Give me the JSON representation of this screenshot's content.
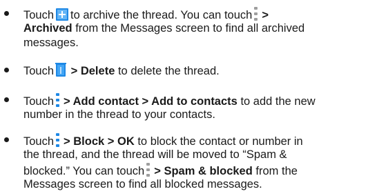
{
  "items": [
    {
      "l1a": "Touch",
      "l1b": "to archive the thread. You can touch",
      "l1c": ">",
      "l2a": "Archived",
      "l2b": "from the Messages screen to find all archived",
      "l3": "messages.",
      "icon1": "archive-icon",
      "icon2": "overflow-menu-icon"
    },
    {
      "a": "Touch",
      "b": "> Delete",
      "c": "to delete the thread.",
      "icon": "trash-icon"
    },
    {
      "a": "Touch",
      "b": "> Add contact > Add to contacts",
      "c": "to add the new",
      "l2": "number in the thread to your contacts.",
      "icon": "overflow-menu-icon"
    },
    {
      "a": "Touch",
      "b": "> Block > OK",
      "c": "to block the contact or number in",
      "l2": "the thread, and the thread will be moved to “Spam &",
      "l3a": "blocked.” You can touch",
      "l3b": "> Spam & blocked",
      "l3c": "from the",
      "l4": "Messages screen to find all blocked messages.",
      "icon": "overflow-menu-icon"
    }
  ],
  "colors": {
    "text": "#1a1a1a",
    "icon_blue": "#1e88e5",
    "icon_grey": "#9e9e9e"
  }
}
